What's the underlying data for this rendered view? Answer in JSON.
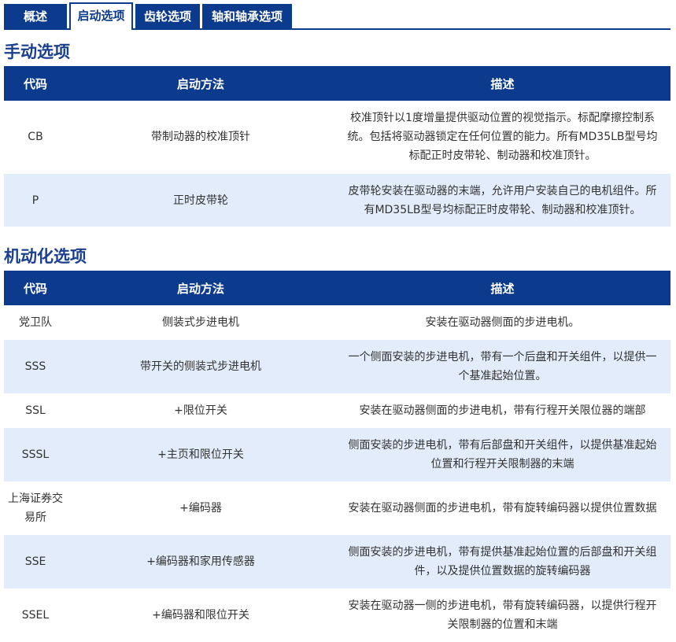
{
  "tabs": [
    {
      "label": "概述",
      "active": false
    },
    {
      "label": "启动选项",
      "active": true
    },
    {
      "label": "齿轮选项",
      "active": false
    },
    {
      "label": "轴和轴承选项",
      "active": false
    }
  ],
  "colors": {
    "brand": "#0c3a8c",
    "row_alt": "#e2ecfa",
    "title": "#1a3f8f"
  },
  "manual": {
    "title": "手动选项",
    "headers": {
      "code": "代码",
      "method": "启动方法",
      "desc": "描述"
    },
    "rows": [
      {
        "code": "CB",
        "method": "带制动器的校准顶针",
        "desc": "校准顶针以1度增量提供驱动位置的视觉指示。标配摩擦控制系统。包括将驱动器锁定在任何位置的能力。所有MD35LB型号均标配正时皮带轮、制动器和校准顶针。"
      },
      {
        "code": "P",
        "method": "正时皮带轮",
        "desc": "皮带轮安装在驱动器的末端，允许用户安装自己的电机组件。所有MD35LB型号均标配正时皮带轮、制动器和校准顶针。"
      }
    ]
  },
  "motor": {
    "title": "机动化选项",
    "headers": {
      "code": "代码",
      "method": "启动方法",
      "desc": "描述"
    },
    "rows": [
      {
        "code": "党卫队",
        "method": "侧装式步进电机",
        "desc": "安装在驱动器侧面的步进电机。"
      },
      {
        "code": "SSS",
        "method": "带开关的侧装式步进电机",
        "desc": "一个侧面安装的步进电机，带有一个后盘和开关组件，以提供一个基准起始位置。"
      },
      {
        "code": "SSL",
        "method": "+限位开关",
        "desc": "安装在驱动器侧面的步进电机，带有行程开关限位器的端部"
      },
      {
        "code": "SSSL",
        "method": "+主页和限位开关",
        "desc": "侧面安装的步进电机，带有后部盘和开关组件，以提供基准起始位置和行程开关限制器的末端"
      },
      {
        "code": "上海证券交易所",
        "method": "+编码器",
        "desc": "安装在驱动器侧面的步进电机，带有旋转编码器以提供位置数据"
      },
      {
        "code": "SSE",
        "method": "+编码器和家用传感器",
        "desc": "侧面安装的步进电机，带有提供基准起始位置的后部盘和开关组件，以及提供位置数据的旋转编码器"
      },
      {
        "code": "SSEL",
        "method": "+编码器和限位开关",
        "desc": "安装在驱动器一侧的步进电机，带有旋转编码器，以提供行程开关限制器的位置和末端"
      }
    ]
  }
}
